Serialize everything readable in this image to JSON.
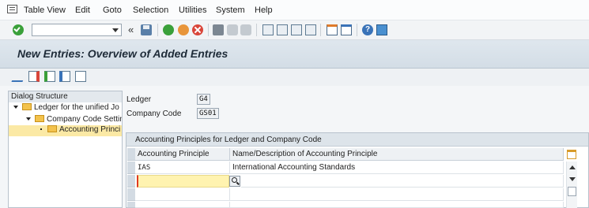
{
  "menu": {
    "items": [
      "Table View",
      "Edit",
      "Goto",
      "Selection",
      "Utilities",
      "System",
      "Help"
    ]
  },
  "toolbar": {
    "command_field_value": ""
  },
  "title": "New Entries: Overview of Added Entries",
  "tree": {
    "header": "Dialog Structure",
    "items": [
      {
        "label": "Ledger for the unified Jo"
      },
      {
        "label": "Company Code Settin"
      },
      {
        "label": "Accounting Princi"
      }
    ]
  },
  "fields": {
    "ledger_label": "Ledger",
    "ledger_value": "G4",
    "company_code_label": "Company Code",
    "company_code_value": "GS01"
  },
  "table": {
    "caption": "Accounting Principles for Ledger and Company Code",
    "columns": [
      "Accounting Principle",
      "Name/Description of Accounting Principle"
    ],
    "rows": [
      [
        "IAS",
        "International Accounting Standards"
      ],
      [
        "",
        ""
      ]
    ]
  },
  "colors": {
    "title_bg": "#d3dde6",
    "input_highlight": "#fff3b0",
    "input_error_border": "#e03a20",
    "confirm_green": "#3aa03a"
  }
}
